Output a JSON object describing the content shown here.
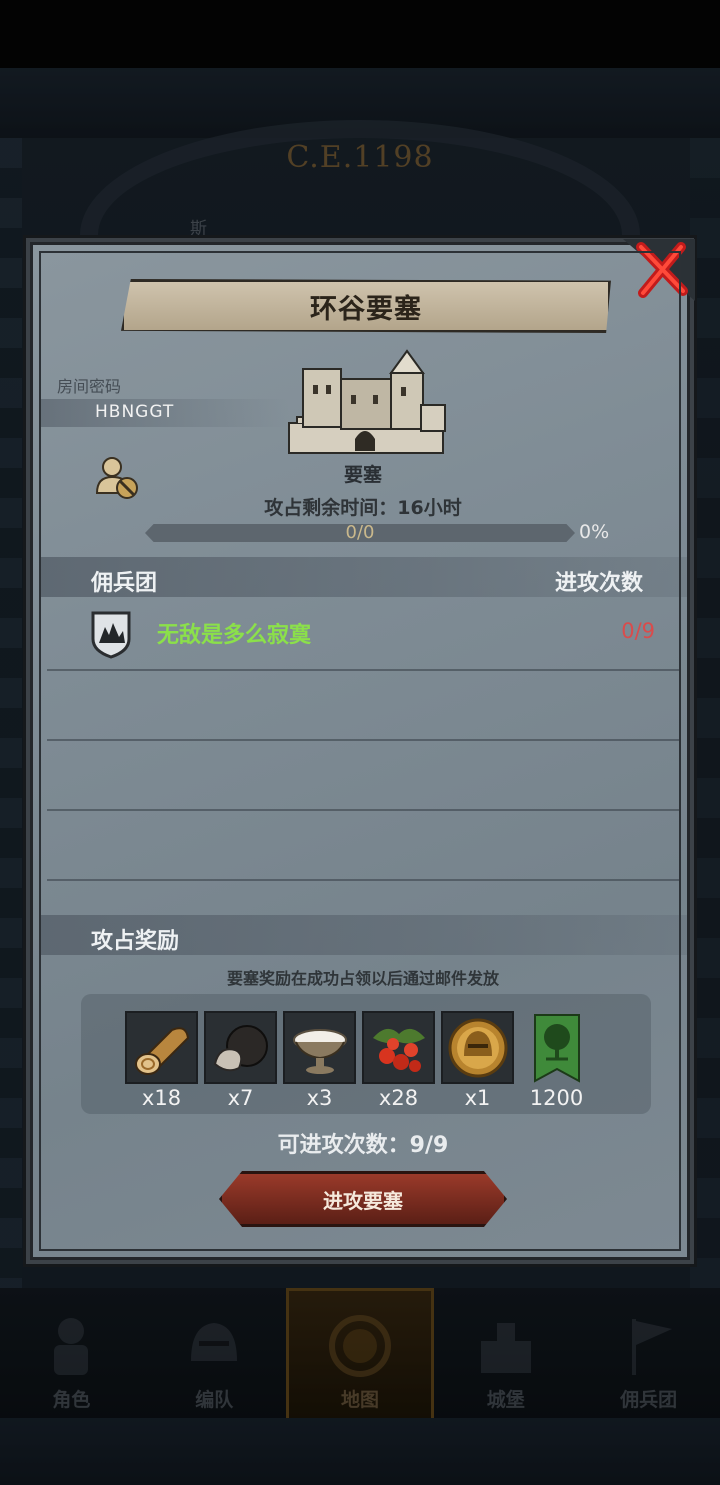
{
  "background": {
    "era": "C.E.1198",
    "faded_text": "斯"
  },
  "bottom_nav": {
    "tabs": [
      {
        "label": "角色",
        "icon": "knight-icon"
      },
      {
        "label": "编队",
        "icon": "helmet-icon"
      },
      {
        "label": "地图",
        "icon": "map-compass-icon",
        "active": true
      },
      {
        "label": "城堡",
        "icon": "castle-icon"
      },
      {
        "label": "佣兵团",
        "icon": "flag-icon"
      }
    ]
  },
  "modal": {
    "title": "环谷要塞",
    "room_code_label": "房间密码",
    "room_code": "HBNGGT",
    "fortress_label": "要塞",
    "remaining_time": "攻占剩余时间：16小时",
    "progress_text": "0/0",
    "progress_percent": "0%",
    "progress_fraction": 0,
    "mercenary_header": "佣兵团",
    "attack_count_header": "进攻次数",
    "mercenaries": [
      {
        "name": "无敌是多么寂寞",
        "count": "0/9"
      }
    ],
    "reward_header": "攻占奖励",
    "reward_note": "要塞奖励在成功占领以后通过邮件发放",
    "rewards": [
      {
        "name": "wood-log-icon",
        "qty": "x18"
      },
      {
        "name": "truffle-icon",
        "qty": "x7"
      },
      {
        "name": "salt-bowl-icon",
        "qty": "x3"
      },
      {
        "name": "berries-icon",
        "qty": "x28"
      },
      {
        "name": "gold-helmet-coin-icon",
        "qty": "x1"
      },
      {
        "name": "tree-banner-icon",
        "qty": "1200"
      }
    ],
    "attempts": "可进攻次数：9/9",
    "attack_button": "进攻要塞"
  },
  "colors": {
    "mercenary_name": "#8be04a",
    "attack_count": "#d94c4c",
    "button": "#7a2c20",
    "panel": "#7f8c95"
  }
}
